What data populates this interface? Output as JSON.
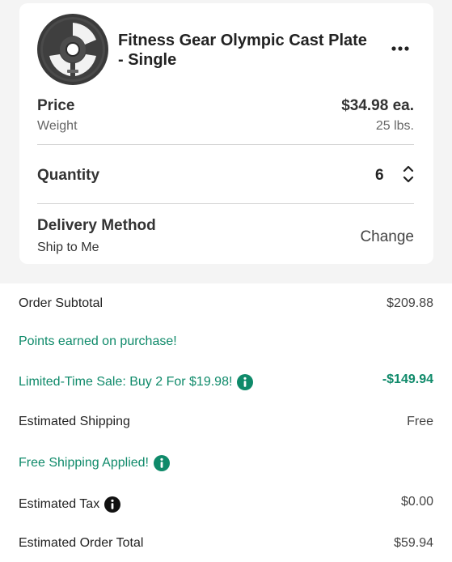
{
  "product": {
    "title": "Fitness Gear Olympic Cast Plate - Single",
    "price_label": "Price",
    "price_value": "$34.98 ea.",
    "weight_label": "Weight",
    "weight_value": "25 lbs.",
    "quantity_label": "Quantity",
    "quantity_value": "6",
    "delivery_label": "Delivery Method",
    "delivery_value": "Ship to Me",
    "change_label": "Change",
    "image_icon": "weight-plate"
  },
  "summary": {
    "subtotal_label": "Order Subtotal",
    "subtotal_value": "$209.88",
    "points_label": "Points earned on purchase!",
    "sale_label": "Limited-Time Sale: Buy 2 For $19.98!",
    "sale_value": "-$149.94",
    "shipping_label": "Estimated Shipping",
    "shipping_value": "Free",
    "free_shipping_label": "Free Shipping Applied!",
    "tax_label": "Estimated Tax",
    "tax_value": "$0.00",
    "total_label": "Estimated Order Total",
    "total_value": "$59.94"
  },
  "colors": {
    "accent_green": "#0f8a6a",
    "card_bg": "#ffffff",
    "page_bg": "#f4f4f4"
  }
}
